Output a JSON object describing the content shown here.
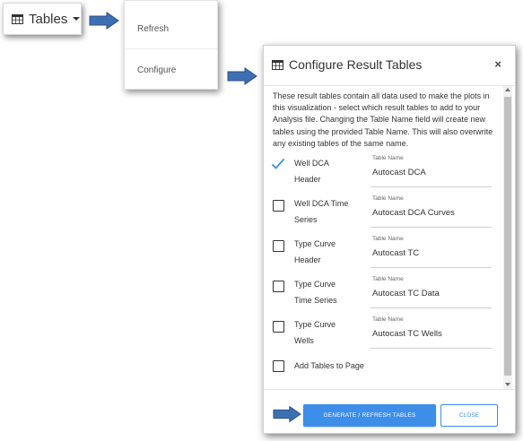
{
  "tables_button": {
    "label": "Tables"
  },
  "menu": {
    "items": [
      {
        "label": "Refresh"
      },
      {
        "label": "Configure"
      }
    ]
  },
  "modal": {
    "title": "Configure Result Tables",
    "close_symbol": "×",
    "description": "These result tables contain all data used to make the plots in this visualization - select which result tables to add to your Analysis file. Changing the Table Name field will create new tables using the provided Table Name. This will also overwrite any existing tables of the same name.",
    "table_name_caption": "Table Name",
    "rows": [
      {
        "line1": "Well DCA",
        "line2": "Header",
        "checked": true,
        "table_name": "Autocast DCA"
      },
      {
        "line1": "Well DCA Time",
        "line2": "Series",
        "checked": false,
        "table_name": "Autocast DCA Curves"
      },
      {
        "line1": "Type Curve",
        "line2": "Header",
        "checked": false,
        "table_name": "Autocast TC"
      },
      {
        "line1": "Type Curve",
        "line2": "Time Series",
        "checked": false,
        "table_name": "Autocast TC Data"
      },
      {
        "line1": "Type Curve",
        "line2": "Wells",
        "checked": false,
        "table_name": "Autocast TC Wells"
      }
    ],
    "add_to_page": {
      "label": "Add Tables to Page",
      "checked": false
    },
    "generate_button": "GENERATE / REFRESH TABLES",
    "close_button": "CLOSE"
  },
  "colors": {
    "primary": "#3d8ee8",
    "arrow_fill": "#3d6fb3",
    "arrow_stroke": "#2b4f86",
    "checkmark": "#3d8ee8"
  },
  "icons": [
    "table-icon",
    "caret-down-icon",
    "arrow-right-icon",
    "close-icon",
    "checkmark-icon",
    "checkbox-icon"
  ]
}
